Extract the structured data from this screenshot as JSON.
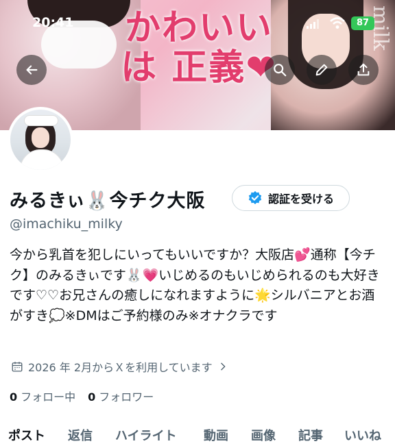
{
  "status_bar": {
    "time": "20:41",
    "battery": "87"
  },
  "banner": {
    "headline": "かわいい は 正義❤",
    "side_text": "milk"
  },
  "profile": {
    "display_name": "みるきぃ🐰今チク大阪",
    "handle": "@imachiku_milky",
    "verify_label": "認証を受ける",
    "bio": "今から乳首を犯しにいってもいいですか？大阪店💕通称【今チク】のみるきぃです🐰💗いじめるのもいじめられるのも大好きです♡♡お兄さんの癒しになれますように🌟シルバニアとお酒がすき💭※DMはご予約様のみ※オナクラです",
    "joined": "2026 年 2月からＸを利用しています",
    "following_count": "0",
    "following_label": "フォロー中",
    "followers_count": "0",
    "followers_label": "フォロワー"
  },
  "tabs": [
    "ポスト",
    "返信",
    "ハイライト",
    "動画",
    "画像",
    "記事",
    "いいね"
  ],
  "colors": {
    "accent": "#1d9bf0",
    "headline": "#e23d6d",
    "muted": "#536471"
  },
  "icons": [
    "back-arrow-icon",
    "search-icon",
    "edit-pencil-icon",
    "share-icon",
    "verified-badge-icon",
    "calendar-icon",
    "chevron-right-icon"
  ]
}
